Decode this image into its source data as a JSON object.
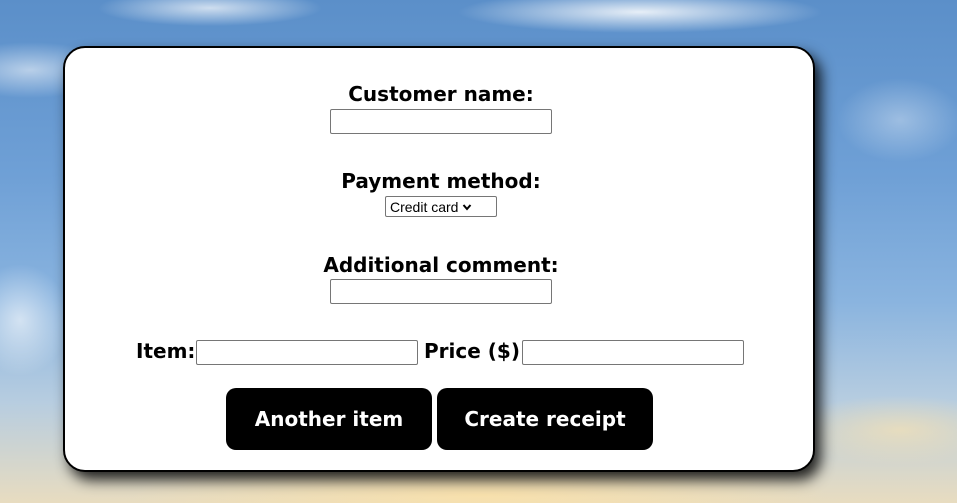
{
  "form": {
    "customer_name_label": "Customer name:",
    "customer_name_value": "",
    "payment_method_label": "Payment method:",
    "payment_method_selected": "Credit card",
    "additional_comment_label": "Additional comment:",
    "additional_comment_value": "",
    "item_label": "Item:",
    "item_value": "",
    "price_label": "Price ($):",
    "price_value": "",
    "another_item_button": "Another item",
    "create_receipt_button": "Create receipt"
  },
  "icons": {
    "select_arrow": "chevron-down-icon"
  },
  "colors": {
    "card_background": "#ffffff",
    "button_background": "#000000",
    "button_text": "#ffffff"
  }
}
